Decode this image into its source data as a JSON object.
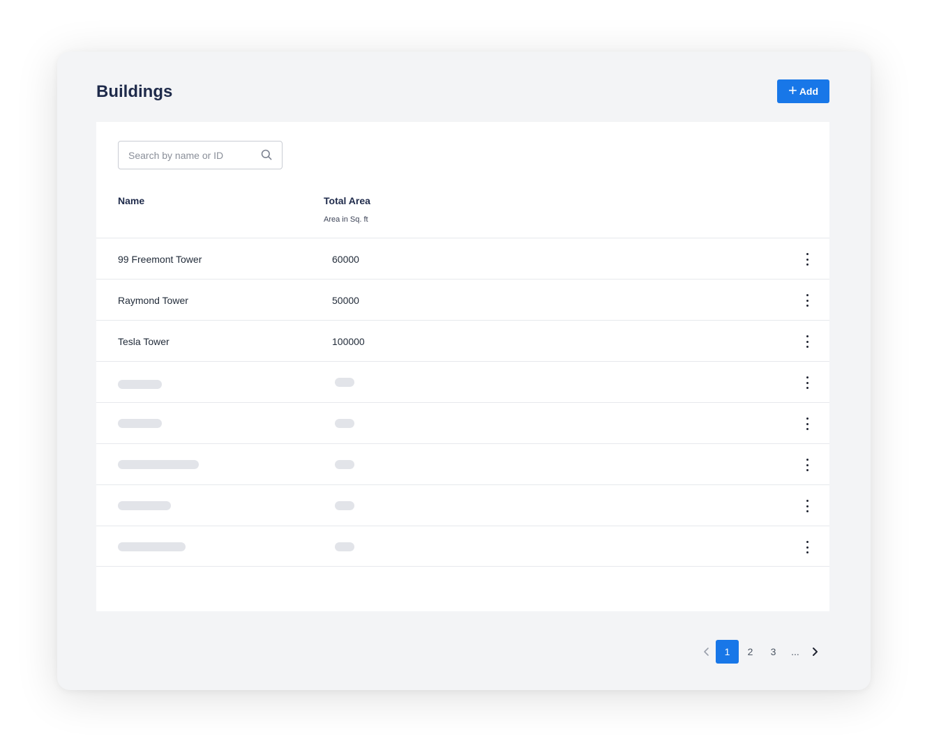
{
  "header": {
    "title": "Buildings",
    "add_label": "Add"
  },
  "search": {
    "placeholder": "Search by name or ID",
    "value": ""
  },
  "table": {
    "columns": [
      {
        "label": "Name",
        "sublabel": ""
      },
      {
        "label": "Total Area",
        "sublabel": "Area in Sq. ft"
      }
    ],
    "rows": [
      {
        "name": "99 Freemont Tower",
        "area": "60000"
      },
      {
        "name": "Raymond Tower",
        "area": "50000"
      },
      {
        "name": "Tesla Tower",
        "area": "100000"
      }
    ],
    "loading_rows": 5
  },
  "pagination": {
    "pages": [
      "1",
      "2",
      "3"
    ],
    "current": "1",
    "ellipsis": "..."
  },
  "colors": {
    "accent": "#1877e8",
    "title": "#1e2a4a",
    "skeleton": "#e2e4e9"
  }
}
